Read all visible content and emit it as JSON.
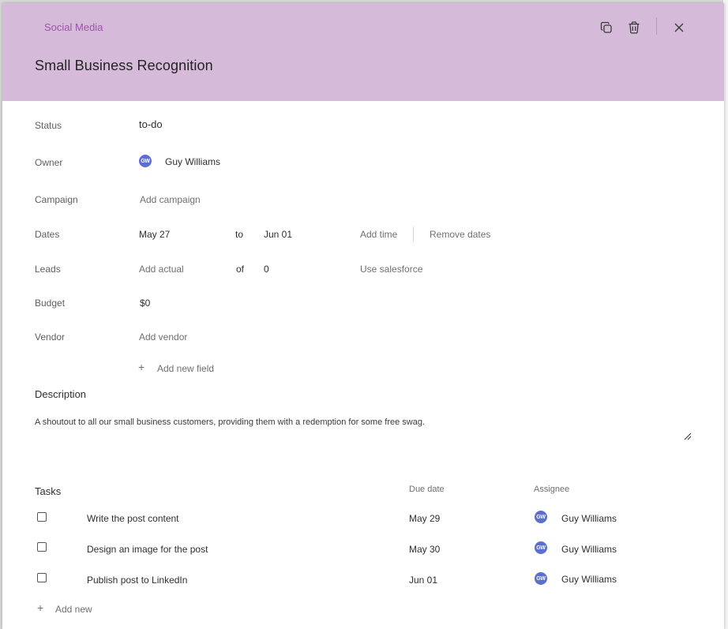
{
  "header": {
    "category": "Social Media",
    "title": "Small Business Recognition",
    "color": "#d5bbd9"
  },
  "fields": {
    "status": {
      "label": "Status",
      "value": "to-do"
    },
    "owner": {
      "label": "Owner",
      "initials": "GW",
      "name": "Guy Williams"
    },
    "campaign": {
      "label": "Campaign",
      "placeholder": "Add campaign"
    },
    "dates": {
      "label": "Dates",
      "start": "May 27",
      "to": "to",
      "end": "Jun 01",
      "add_time": "Add time",
      "remove": "Remove dates"
    },
    "leads": {
      "label": "Leads",
      "placeholder": "Add actual",
      "of": "of",
      "target": "0",
      "salesforce": "Use salesforce"
    },
    "budget": {
      "label": "Budget",
      "value": "$0"
    },
    "vendor": {
      "label": "Vendor",
      "placeholder": "Add vendor"
    },
    "add_field": "Add new field"
  },
  "description": {
    "title": "Description",
    "text": "A shoutout to all our small business customers, providing them with a redemption for some free swag."
  },
  "tasks": {
    "title": "Tasks",
    "col_due": "Due date",
    "col_assignee": "Assignee",
    "rows": [
      {
        "text": "Write the post content",
        "due": "May 29",
        "initials": "GW",
        "assignee": "Guy Williams",
        "checked": false
      },
      {
        "text": "Design an image for the post",
        "due": "May 30",
        "initials": "GW",
        "assignee": "Guy Williams",
        "checked": false
      },
      {
        "text": "Publish post to LinkedIn",
        "due": "Jun 01",
        "initials": "GW",
        "assignee": "Guy Williams",
        "checked": false
      }
    ],
    "add_new": "Add new"
  },
  "icons": {
    "duplicate": "copy-icon",
    "delete": "trash-icon",
    "close": "close-icon",
    "plus": "plus-icon",
    "resize": "resize-handle-icon"
  },
  "colors": {
    "avatar": "#5b6fd0",
    "category_text": "#9a54a8"
  }
}
